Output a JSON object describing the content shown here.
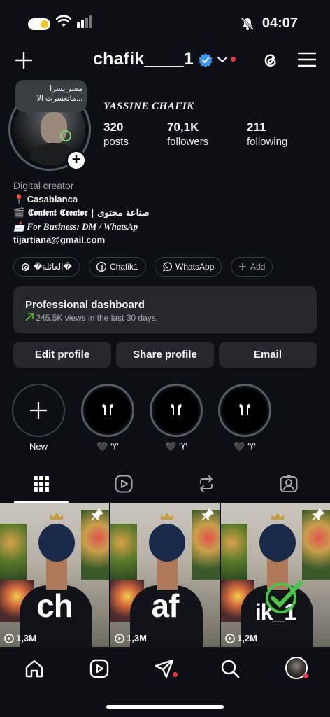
{
  "status_bar": {
    "time": "04:07"
  },
  "header": {
    "username": "chafik____1"
  },
  "profile": {
    "note": "مسر يسرا ماتعسرت الا...",
    "display_name": "YASSINE CHAFIK",
    "posts_count": "320",
    "posts_label": "posts",
    "followers_count": "70,1K",
    "followers_label": "followers",
    "following_count": "211",
    "following_label": "following"
  },
  "bio": {
    "category": "Digital creator",
    "line1": "📍 Casablanca",
    "line2": "🎬 𝕮𝖔𝖓𝖙𝖊𝖓𝖙 𝕮𝖗𝖊𝖆𝖙𝖔𝖗 | صناعة محتوى",
    "line3": "📩 For Business: DM / WhatsAp",
    "email": "tijartiana@gmail.com"
  },
  "chips": [
    {
      "label": "�العائلة�",
      "icon": "threads-icon"
    },
    {
      "label": "Chafik1",
      "icon": "facebook-icon"
    },
    {
      "label": "WhatsApp",
      "icon": "whatsapp-icon"
    },
    {
      "label": "Add",
      "icon": "plus-icon"
    }
  ],
  "dashboard": {
    "title": "Professional dashboard",
    "subtitle": "245.5K views in the last 30 days."
  },
  "buttons": {
    "edit": "Edit profile",
    "share": "Share profile",
    "email": "Email"
  },
  "highlights": [
    {
      "label": "New"
    },
    {
      "label": "🖤 ♈"
    },
    {
      "label": "🖤 ♈"
    },
    {
      "label": "🖤 ♈"
    }
  ],
  "grid": [
    {
      "text": "ch",
      "views": "1,3M"
    },
    {
      "text": "af",
      "views": "1,3M"
    },
    {
      "text": "ik_1",
      "views": "1,2M"
    }
  ],
  "colors": {
    "background": "#0c1014",
    "surface": "#25292e",
    "accent_red": "#ff3040",
    "verified_blue": "#3897f0"
  }
}
